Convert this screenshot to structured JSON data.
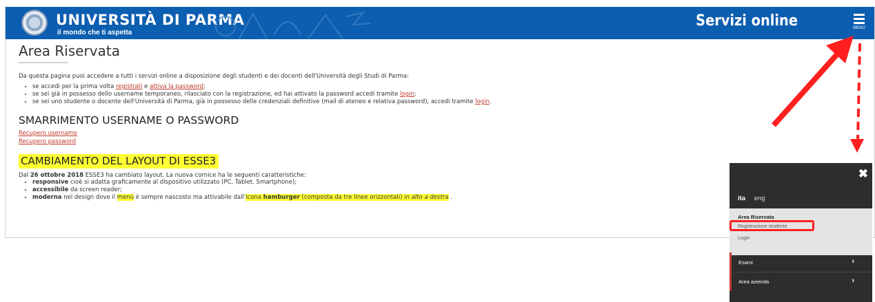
{
  "header": {
    "university_name": "UNIVERSITÀ DI PARMA",
    "tagline": "il mondo che ti aspetta",
    "service_title": "Servizi online",
    "menu_label": "MENU",
    "brand_color": "#0c5eb0"
  },
  "main": {
    "title": "Area Riservata",
    "intro": "Da questa pagina puoi accedere a tutti i servizi online a disposizione degli studenti e dei docenti dell'Università degli Studi di Parma:",
    "bullets": {
      "b1_pre": "se accedi per la prima volta ",
      "b1_link1": "registrati",
      "b1_mid": " e ",
      "b1_link2": "attiva la password",
      "b1_end": ";",
      "b2_pre": "se sei già in possesso dello username temporaneo, rilasciato con la registrazione, ed hai attivato la password accedi tramite ",
      "b2_link": "login",
      "b2_end": ";",
      "b3_pre": "se sei uno studente o docente dell'Università di Parma, già in possesso delle credenziali definitive (mail di ateneo e relativa password), accedi tramite ",
      "b3_link": "login",
      "b3_end": "."
    },
    "lost_title": "SMARRIMENTO USERNAME O PASSWORD",
    "recover_username": "Recupero username",
    "recover_password": "Recupero password",
    "layout_title": "CAMBIAMENTO DEL LAYOUT DI ESSE3",
    "layout_intro_pre": "Dal ",
    "layout_intro_date": "26 ottobre 2018",
    "layout_intro_post": " ESSE3 ha cambiato layout. La nuova cornice ha le seguenti caratteristiche:",
    "features": {
      "f1_bold": "responsive",
      "f1_rest": " cioè si adatta graficamente al dispositivo utilizzato (PC, Tablet, Smartphone);",
      "f2_bold": "accessibile",
      "f2_rest": " da screen reader;",
      "f3_bold": "moderna",
      "f3_a": " nel design dove il ",
      "f3_menu": "menù",
      "f3_b": " è sempre nascosto ma attivabile dall'",
      "f3_icona": "icona ",
      "f3_hamburger": "hamburger",
      "f3_paren": " (composta da tre linee orizzontali) ",
      "f3_italic": "in alto a destra",
      "f3_end": " ."
    }
  },
  "menu_panel": {
    "close_icon": "✖",
    "lang_ita": "ita",
    "lang_eng": "eng",
    "section_label": "Area Riservata",
    "items": [
      "Registrazione studente",
      "Login"
    ],
    "dark_items": [
      "Esami",
      "Area azienda"
    ],
    "chevron": "›"
  },
  "annotations": {
    "arrow_color": "#ff1f1f"
  }
}
